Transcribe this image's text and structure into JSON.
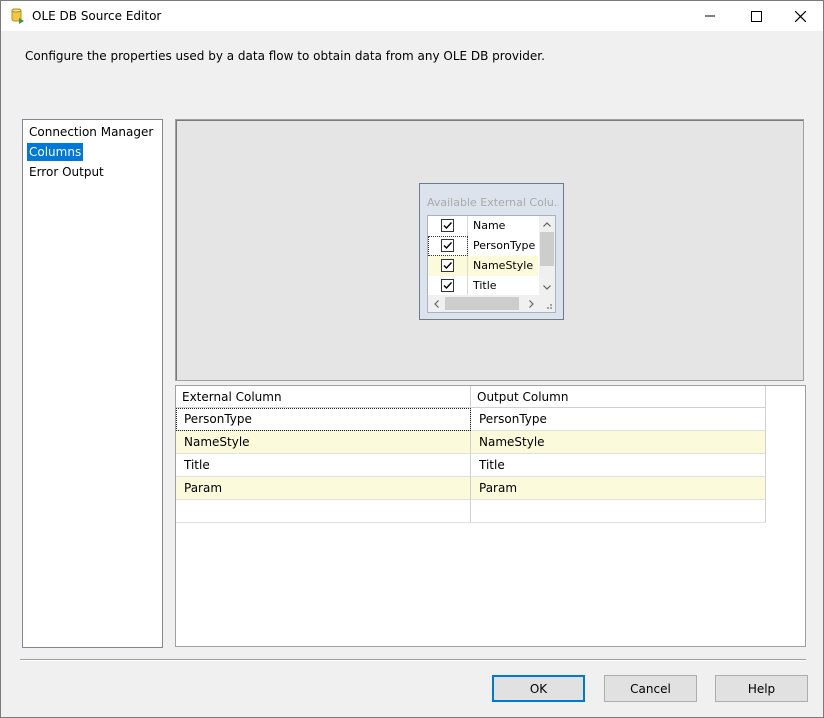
{
  "window": {
    "title": "OLE DB Source Editor",
    "icons": {
      "app": "ole-db-source-icon",
      "minimize": "minimize-icon",
      "maximize": "maximize-icon",
      "close": "close-icon"
    }
  },
  "description": "Configure the properties used by a data flow to obtain data from any OLE DB provider.",
  "nav": {
    "items": [
      {
        "label": "Connection Manager",
        "selected": false
      },
      {
        "label": "Columns",
        "selected": true
      },
      {
        "label": "Error Output",
        "selected": false
      }
    ]
  },
  "available_columns": {
    "title": "Available External Colu...",
    "rows": [
      {
        "name": "Name",
        "checked": true
      },
      {
        "name": "PersonType",
        "checked": true
      },
      {
        "name": "NameStyle",
        "checked": true
      },
      {
        "name": "Title",
        "checked": true
      }
    ]
  },
  "mapping": {
    "headers": [
      "External Column",
      "Output Column"
    ],
    "rows": [
      {
        "external": "PersonType",
        "output": "PersonType"
      },
      {
        "external": "NameStyle",
        "output": "NameStyle"
      },
      {
        "external": "Title",
        "output": "Title"
      },
      {
        "external": "Param",
        "output": "Param"
      },
      {
        "external": "",
        "output": ""
      }
    ]
  },
  "buttons": {
    "ok": "OK",
    "cancel": "Cancel",
    "help": "Help"
  },
  "colors": {
    "selection": "#0078d7",
    "alt_row": "#fbfbdc"
  }
}
